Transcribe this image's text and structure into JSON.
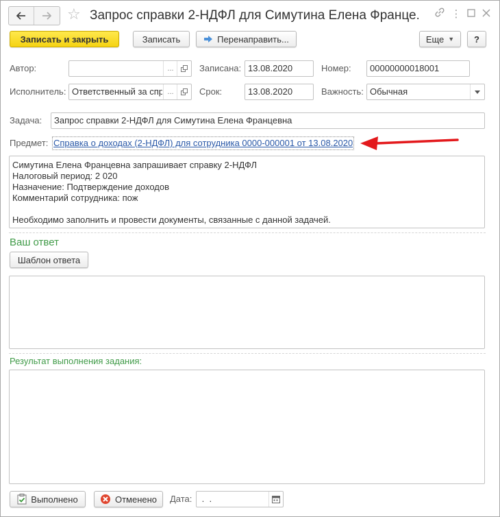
{
  "window": {
    "title": "Запрос справки 2-НДФЛ для Симутина Елена Франце..."
  },
  "toolbar": {
    "save_close_label": "Записать и закрыть",
    "save_label": "Записать",
    "redirect_label": "Перенаправить...",
    "more_label": "Еще",
    "help_label": "?"
  },
  "form": {
    "author_label": "Автор:",
    "author_value": "",
    "written_label": "Записана:",
    "written_value": "13.08.2020",
    "number_label": "Номер:",
    "number_value": "00000000018001",
    "executor_label": "Исполнитель:",
    "executor_value": "Ответственный за спр",
    "deadline_label": "Срок:",
    "deadline_value": "13.08.2020",
    "importance_label": "Важность:",
    "importance_value": "Обычная",
    "task_label": "Задача:",
    "task_value": "Запрос справки 2-НДФЛ для Симутина Елена Францевна",
    "subject_label": "Предмет:",
    "subject_link": "Справка о доходах (2-НДФЛ) для сотрудника 0000-000001 от 13.08.2020"
  },
  "description": {
    "lines": [
      "Симутина Елена Францевна запрашивает справку 2-НДФЛ",
      "Налоговый период: 2 020",
      "Назначение: Подтверждение доходов",
      "Комментарий сотрудника: пож",
      "",
      "Необходимо заполнить и провести документы, связанные с данной задачей."
    ]
  },
  "answer": {
    "header": "Ваш ответ",
    "template_button": "Шаблон ответа"
  },
  "result": {
    "header": "Результат выполнения задания:"
  },
  "footer": {
    "done_label": "Выполнено",
    "cancel_label": "Отменено",
    "date_label": "Дата:",
    "date_value": " .  ."
  },
  "colors": {
    "primary_button": "#f5d312",
    "link": "#2a59a8",
    "green_header": "#3f9a47",
    "annotation_arrow": "#e3191c"
  }
}
